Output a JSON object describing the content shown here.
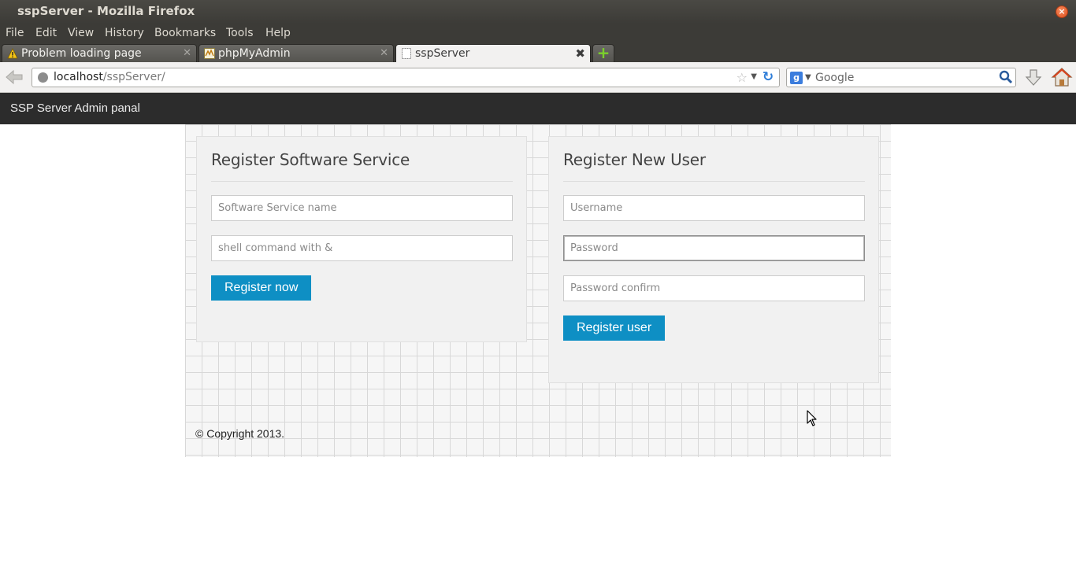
{
  "window": {
    "title": "sspServer - Mozilla Firefox",
    "close_glyph": "×"
  },
  "menu": {
    "items": [
      "File",
      "Edit",
      "View",
      "History",
      "Bookmarks",
      "Tools",
      "Help"
    ]
  },
  "tabs": [
    {
      "label": "Problem loading page",
      "icon": "warning-icon",
      "active": false
    },
    {
      "label": "phpMyAdmin",
      "icon": "phpmyadmin-icon",
      "active": false
    },
    {
      "label": "sspServer",
      "icon": "blank-page-icon",
      "active": true
    }
  ],
  "new_tab_glyph": "+",
  "navbar": {
    "url_host": "localhost",
    "url_path": "/sspServer/",
    "search_placeholder": "Google",
    "search_engine_letter": "g"
  },
  "site": {
    "brand": "SSP Server Admin panal",
    "copyright": "© Copyright 2013."
  },
  "software_form": {
    "title": "Register Software Service",
    "name_placeholder": "Software Service name",
    "command_placeholder": "shell command with &",
    "submit_label": "Register now"
  },
  "user_form": {
    "title": "Register New User",
    "username_placeholder": "Username",
    "password_placeholder": "Password",
    "password_confirm_placeholder": "Password confirm",
    "submit_label": "Register user"
  },
  "colors": {
    "button": "#0e8fc4",
    "header": "#2c2c2c"
  }
}
